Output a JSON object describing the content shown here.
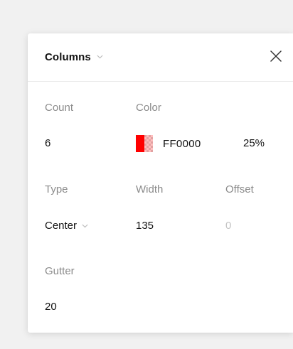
{
  "panel": {
    "title": "Columns",
    "icons": {
      "title_dropdown": "chevron-down-icon",
      "close": "close-icon",
      "type_dropdown": "chevron-down-icon"
    }
  },
  "fields": {
    "count": {
      "label": "Count",
      "value": "6"
    },
    "color": {
      "label": "Color",
      "hex": "FF0000",
      "opacity": "25%",
      "swatch_color": "#ff0000"
    },
    "type": {
      "label": "Type",
      "value": "Center"
    },
    "width": {
      "label": "Width",
      "value": "135"
    },
    "offset": {
      "label": "Offset",
      "value": "0"
    },
    "gutter": {
      "label": "Gutter",
      "value": "20"
    }
  },
  "colors": {
    "background": "#f1f1f1",
    "panel": "#ffffff",
    "label": "#8b8b8b",
    "value": "#111111",
    "disabled_value": "#c4c4c4"
  }
}
